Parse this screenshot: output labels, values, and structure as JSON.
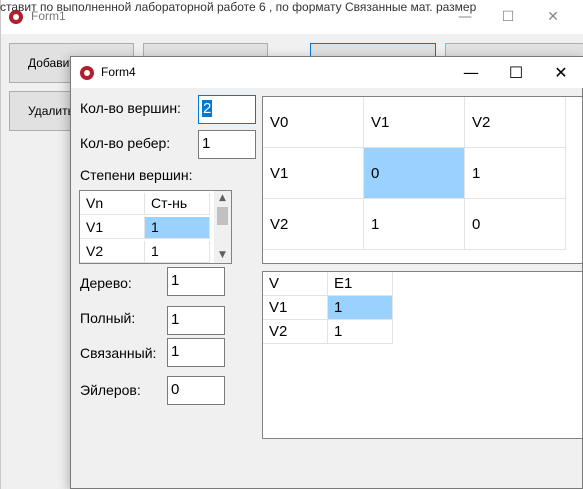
{
  "background_text": "ставит по выполненной лабораторной работе 6 , по формату Связанные мат. размер",
  "form1": {
    "title": "Form1",
    "buttons": [
      {
        "label": "Добавить"
      },
      {
        "label": ""
      },
      {
        "label": ""
      },
      {
        "label": ""
      },
      {
        "label": "Удалить"
      }
    ],
    "controls": {
      "minimize": "—",
      "maximize": "☐",
      "close": "✕"
    }
  },
  "form4": {
    "title": "Form4",
    "controls": {
      "minimize": "—",
      "maximize": "☐",
      "close": "✕"
    },
    "vertex_count": {
      "label": "Кол-во вершин:",
      "value": "2"
    },
    "edge_count": {
      "label": "Кол-во ребер:",
      "value": "1"
    },
    "degrees": {
      "label": "Степени вершин:",
      "columns": [
        "Vn",
        "Ст-нь"
      ],
      "rows": [
        [
          "V1",
          "1"
        ],
        [
          "V2",
          "1"
        ]
      ]
    },
    "tree": {
      "label": "Дерево:",
      "value": "1"
    },
    "complete": {
      "label": "Полный:",
      "value": "1"
    },
    "connected": {
      "label": "Связанный:",
      "value": "1"
    },
    "eulerian": {
      "label": "Эйлеров:",
      "value": "0"
    },
    "adjacency": {
      "header": [
        "V0",
        "V1",
        "V2"
      ],
      "rows": [
        [
          "V1",
          "0",
          "1"
        ],
        [
          "V2",
          "1",
          "0"
        ]
      ]
    },
    "incidence": {
      "header": [
        "V",
        "E1"
      ],
      "rows": [
        [
          "V1",
          "1"
        ],
        [
          "V2",
          "1"
        ]
      ]
    }
  }
}
